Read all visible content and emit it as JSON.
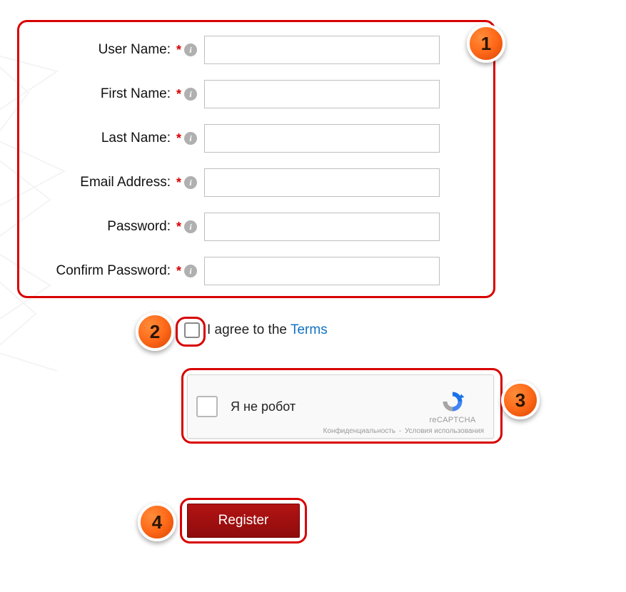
{
  "badges": {
    "n1": "1",
    "n2": "2",
    "n3": "3",
    "n4": "4"
  },
  "form": {
    "fields": [
      {
        "label": "User Name:",
        "value": ""
      },
      {
        "label": "First Name:",
        "value": ""
      },
      {
        "label": "Last Name:",
        "value": ""
      },
      {
        "label": "Email Address:",
        "value": ""
      },
      {
        "label": "Password:",
        "value": ""
      },
      {
        "label": "Confirm Password:",
        "value": ""
      }
    ],
    "required_marker": "*",
    "info_icon_glyph": "i"
  },
  "terms": {
    "text_before": "I agree to the",
    "link_text": "Terms"
  },
  "recaptcha": {
    "label": "Я не робот",
    "brand": "reCAPTCHA",
    "privacy": "Конфиденциальность",
    "sep": "-",
    "terms": "Условия использования"
  },
  "register": {
    "label": "Register"
  }
}
